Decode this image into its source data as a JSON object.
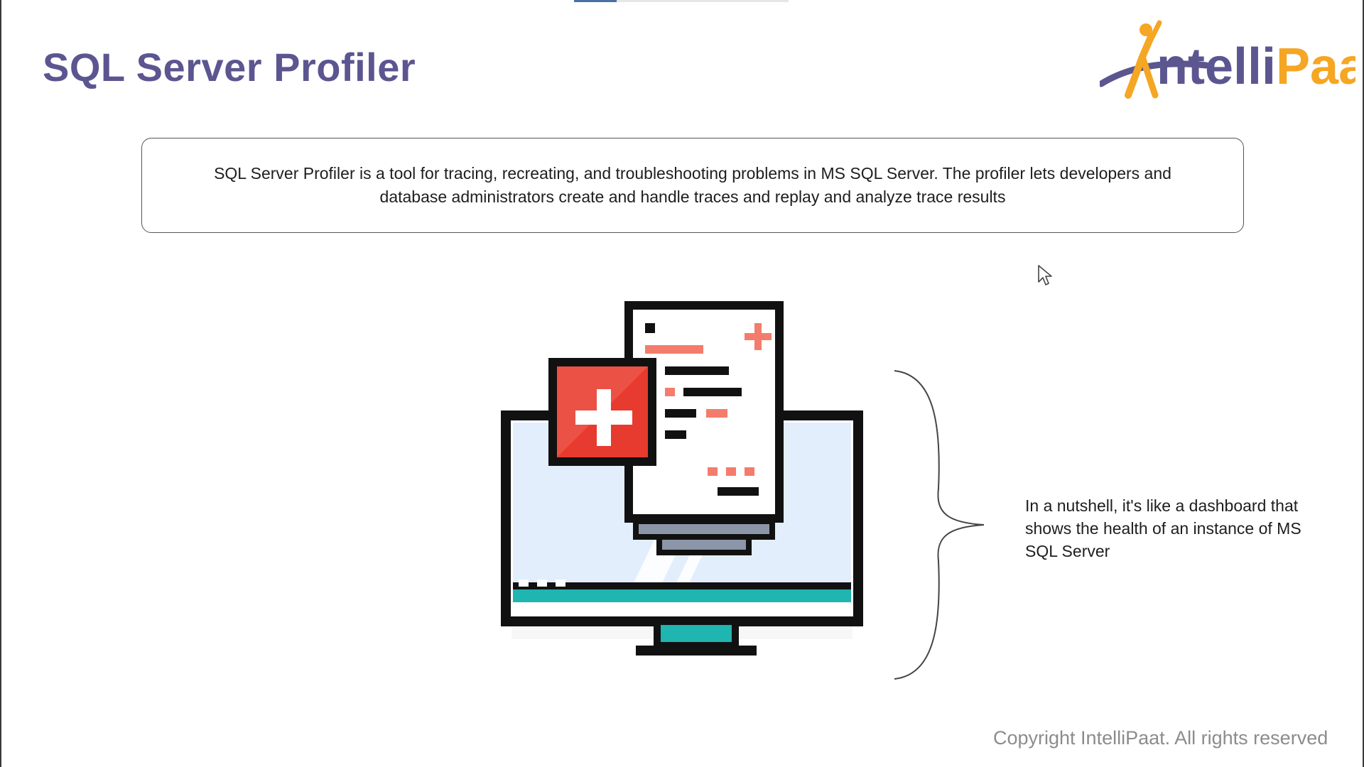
{
  "slide": {
    "title": "SQL Server Profiler",
    "description": "SQL Server Profiler is a tool for tracing, recreating, and troubleshooting problems in MS SQL Server. The profiler lets developers and database administrators create and handle traces and replay and analyze trace results",
    "nutshell": "In a nutshell, it's like a dashboard that shows the health of an instance of MS SQL Server",
    "copyright": "Copyright IntelliPaat. All rights reserved"
  },
  "logo": {
    "text_lead": "ntelli",
    "text_tail": "Paat",
    "brand_color": "#5b5690",
    "accent_color": "#f5a623"
  },
  "progress": {
    "fraction": 0.2
  },
  "colors": {
    "title": "#5b5690",
    "red": "#e63b2e",
    "salmon": "#f47c6c",
    "teal": "#1fb5b0",
    "screen": "#e2eefb",
    "gray": "#8b96a8"
  },
  "icons": {
    "illustration": "monitor-medical-report-icon",
    "brace": "curly-brace-icon",
    "cursor": "mouse-pointer-icon"
  }
}
